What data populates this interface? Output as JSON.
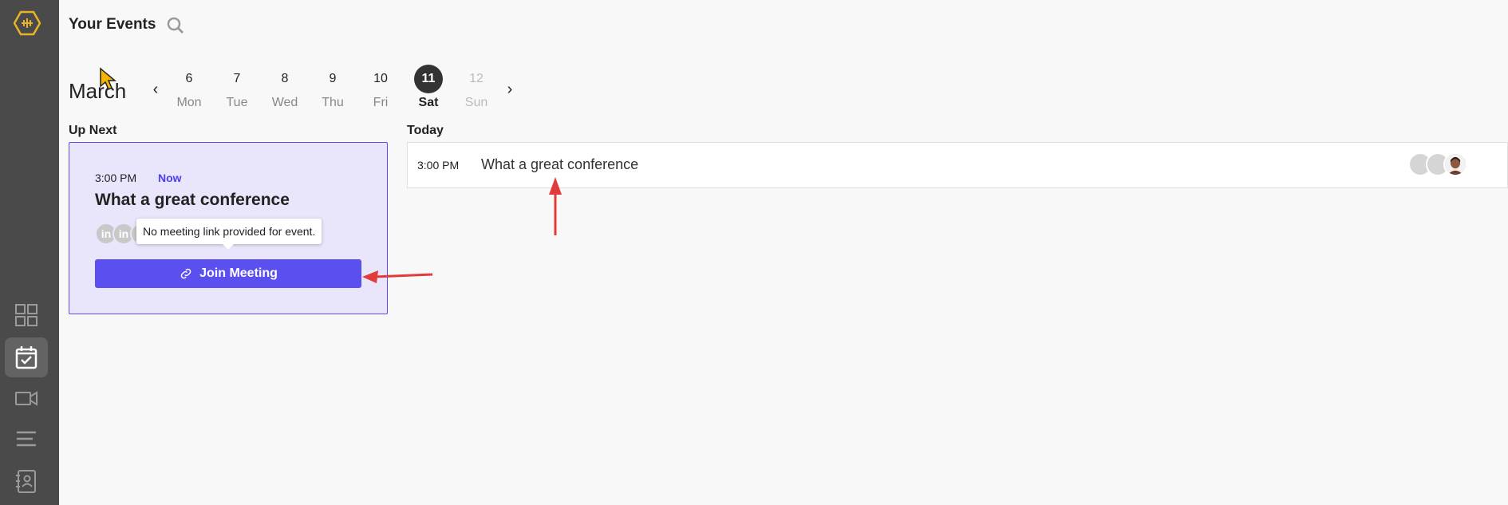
{
  "header": {
    "title": "Your Events"
  },
  "icons": {
    "logo": "hexagon-logo-icon",
    "search": "search-icon",
    "sidebar": [
      "dashboard-grid-icon",
      "calendar-check-icon",
      "video-camera-icon",
      "menu-lines-icon",
      "contacts-book-icon"
    ]
  },
  "calendar": {
    "month": "March",
    "prev_arrow": "‹",
    "next_arrow": "›",
    "days": [
      {
        "num": "6",
        "day": "Mon"
      },
      {
        "num": "7",
        "day": "Tue"
      },
      {
        "num": "8",
        "day": "Wed"
      },
      {
        "num": "9",
        "day": "Thu"
      },
      {
        "num": "10",
        "day": "Fri"
      },
      {
        "num": "11",
        "day": "Sat"
      },
      {
        "num": "12",
        "day": "Sun"
      }
    ],
    "selected": "11"
  },
  "up_next": {
    "label": "Up Next",
    "time": "3:00 PM",
    "status": "Now",
    "title": "What a great conference",
    "avatar_text": "in",
    "tooltip": "No meeting link provided for event.",
    "join_label": "Join Meeting"
  },
  "today": {
    "label": "Today",
    "time": "3:00 PM",
    "title": "What a great conference"
  },
  "colors": {
    "accent": "#5b4ff0",
    "card_bg": "#e9e5fb",
    "sidebar_bg": "#4a4a4a",
    "logo": "#e8b423",
    "annotation": "#e23b3b"
  }
}
